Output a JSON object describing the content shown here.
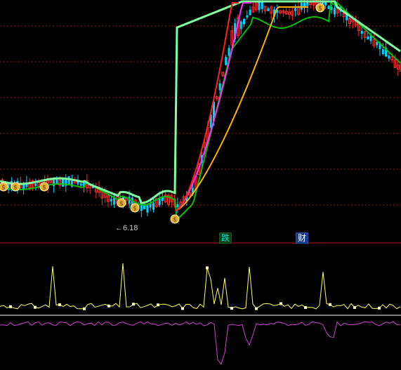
{
  "colors": {
    "background": "#000000",
    "grid": "#8b1a1a",
    "divider": "#b01818",
    "bullish_candle": "#ff2a2a",
    "bearish_candle": "#00d2ff",
    "ma_fast": "#ff2020",
    "ma_mid": "#ff30ff",
    "ma_slow": "#ffb000",
    "band_green": "#00c000",
    "band_light": "#80ffa0",
    "indicator_main": "#ffff60",
    "indicator_marker": "#ffffc0",
    "indicator_sub": "#d040d0",
    "zero_line": "#ffffff",
    "coin_icon": "#e8b030"
  },
  "chart_data": {
    "type": "line",
    "marks": {
      "tag_die": "跌",
      "tag_cai": "财",
      "low_price_label": "←6.18"
    },
    "low_price": 6.18,
    "icons": [
      "money-bag-icon"
    ]
  }
}
